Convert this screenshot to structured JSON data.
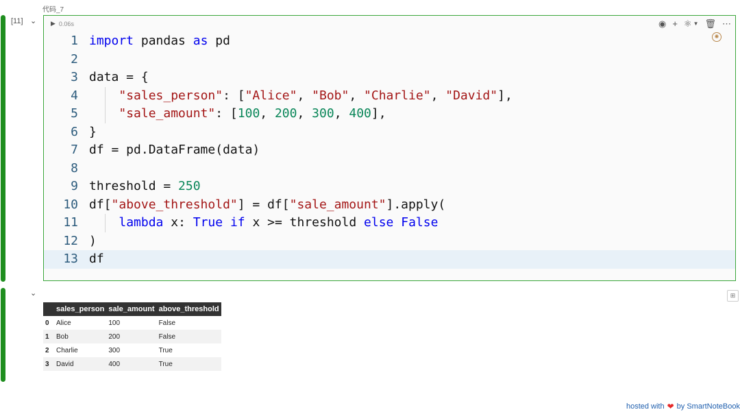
{
  "cell": {
    "label": "代码_7",
    "exec_count": "[11]",
    "duration": "0.06s",
    "collapse_icon": "chevron-down-icon",
    "toolbar_icons": [
      "eye-icon",
      "plus-icon",
      "python-icon",
      "dropdown-icon",
      "trash-icon",
      "more-icon"
    ],
    "badge_icon": "ai-assist-icon"
  },
  "code": [
    {
      "n": "1",
      "tokens": [
        [
          "kw",
          "import"
        ],
        [
          "p",
          " pandas "
        ],
        [
          "kw",
          "as"
        ],
        [
          "p",
          " pd"
        ]
      ]
    },
    {
      "n": "2",
      "tokens": []
    },
    {
      "n": "3",
      "tokens": [
        [
          "p",
          "data = {"
        ]
      ]
    },
    {
      "n": "4",
      "tokens": [
        [
          "p",
          "    "
        ],
        [
          "str",
          "\"sales_person\""
        ],
        [
          "p",
          ": ["
        ],
        [
          "str",
          "\"Alice\""
        ],
        [
          "p",
          ", "
        ],
        [
          "str",
          "\"Bob\""
        ],
        [
          "p",
          ", "
        ],
        [
          "str",
          "\"Charlie\""
        ],
        [
          "p",
          ", "
        ],
        [
          "str",
          "\"David\""
        ],
        [
          "p",
          "],"
        ]
      ]
    },
    {
      "n": "5",
      "tokens": [
        [
          "p",
          "    "
        ],
        [
          "str",
          "\"sale_amount\""
        ],
        [
          "p",
          ": ["
        ],
        [
          "num",
          "100"
        ],
        [
          "p",
          ", "
        ],
        [
          "num",
          "200"
        ],
        [
          "p",
          ", "
        ],
        [
          "num",
          "300"
        ],
        [
          "p",
          ", "
        ],
        [
          "num",
          "400"
        ],
        [
          "p",
          "],"
        ]
      ]
    },
    {
      "n": "6",
      "tokens": [
        [
          "p",
          "}"
        ]
      ]
    },
    {
      "n": "7",
      "tokens": [
        [
          "p",
          "df = pd.DataFrame(data)"
        ]
      ]
    },
    {
      "n": "8",
      "tokens": []
    },
    {
      "n": "9",
      "tokens": [
        [
          "p",
          "threshold = "
        ],
        [
          "num",
          "250"
        ]
      ]
    },
    {
      "n": "10",
      "tokens": [
        [
          "p",
          "df["
        ],
        [
          "str",
          "\"above_threshold\""
        ],
        [
          "p",
          "] = df["
        ],
        [
          "str",
          "\"sale_amount\""
        ],
        [
          "p",
          "].apply("
        ]
      ]
    },
    {
      "n": "11",
      "tokens": [
        [
          "p",
          "    "
        ],
        [
          "kw",
          "lambda"
        ],
        [
          "p",
          " x: "
        ],
        [
          "kw",
          "True"
        ],
        [
          "p",
          " "
        ],
        [
          "kw",
          "if"
        ],
        [
          "p",
          " x >= threshold "
        ],
        [
          "kw",
          "else"
        ],
        [
          "p",
          " "
        ],
        [
          "kw",
          "False"
        ]
      ]
    },
    {
      "n": "12",
      "tokens": [
        [
          "p",
          ")"
        ]
      ]
    },
    {
      "n": "13",
      "tokens": [
        [
          "p",
          "df"
        ]
      ],
      "active": true
    }
  ],
  "output": {
    "columns": [
      "",
      "sales_person",
      "sale_amount",
      "above_threshold"
    ],
    "rows": [
      [
        "0",
        "Alice",
        "100",
        "False"
      ],
      [
        "1",
        "Bob",
        "200",
        "False"
      ],
      [
        "2",
        "Charlie",
        "300",
        "True"
      ],
      [
        "3",
        "David",
        "400",
        "True"
      ]
    ],
    "expand_icon": "expand-icon"
  },
  "footer": {
    "prefix": "hosted with",
    "heart_icon": "heart-icon",
    "suffix": "by SmartNoteBook"
  },
  "colors": {
    "accent": "#1f8e1f",
    "keyword": "#0000ee",
    "string": "#a31515",
    "number": "#098658"
  }
}
